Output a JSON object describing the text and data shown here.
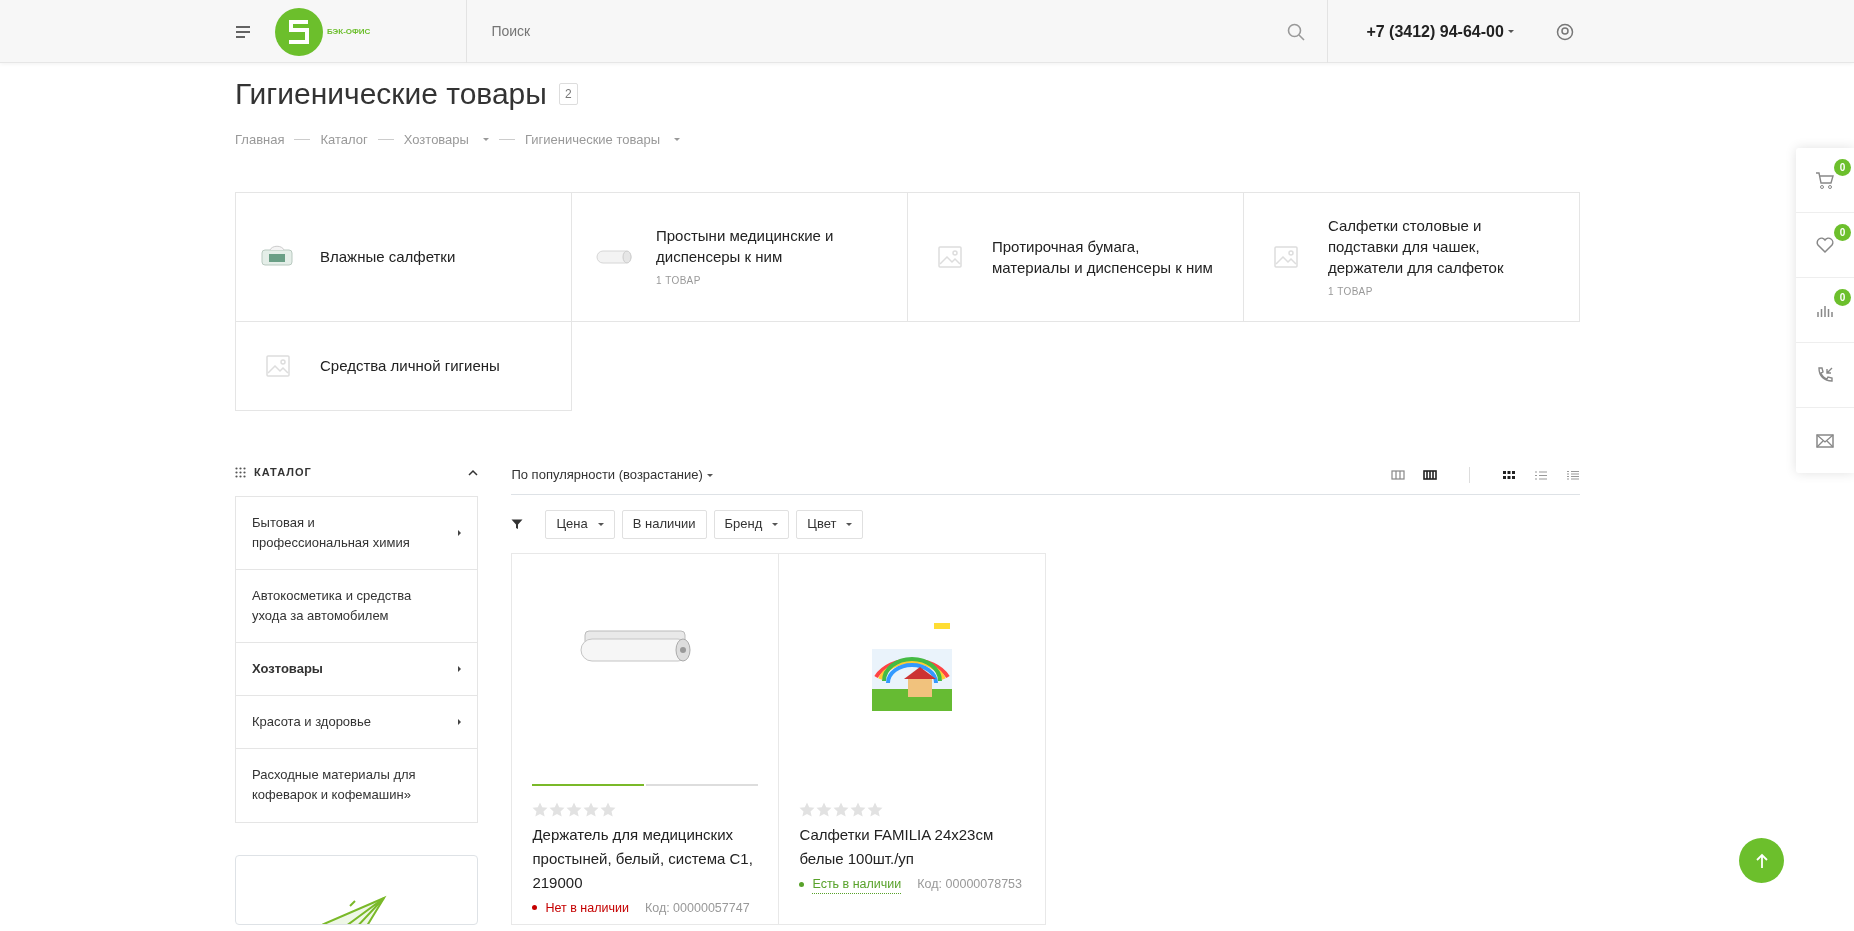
{
  "header": {
    "logo_text": "БЭК-ОФИС",
    "search_placeholder": "Поиск",
    "phone": "+7 (3412) 94-64-00"
  },
  "page": {
    "title": "Гигиенические товары",
    "count": "2",
    "breadcrumbs": [
      {
        "label": "Главная",
        "dropdown": false
      },
      {
        "label": "Каталог",
        "dropdown": false
      },
      {
        "label": "Хозтовары",
        "dropdown": true
      },
      {
        "label": "Гигиенические товары",
        "dropdown": true
      }
    ]
  },
  "categories": [
    {
      "name": "Влажные салфетки",
      "kind": "wipes"
    },
    {
      "name": "Простыни медицинские и диспенсеры к ним",
      "count": "1 ТОВАР",
      "kind": "roll"
    },
    {
      "name": "Протирочная бумага, материалы и диспенсеры к ним",
      "kind": "placeholder"
    },
    {
      "name": "Салфетки столовые и подставки для чашек, держатели для салфеток",
      "count": "1 ТОВАР",
      "kind": "placeholder"
    },
    {
      "name": "Средства личной гигиены",
      "kind": "placeholder"
    }
  ],
  "sidebar": {
    "title": "КАТАЛОГ",
    "expanded": true,
    "items": [
      {
        "label": "Бытовая и профессиональная химия",
        "selected": false,
        "has_children": true
      },
      {
        "label": "Автокосметика и средства ухода за автомобилем",
        "selected": false,
        "has_children": false
      },
      {
        "label": "Хозтовары",
        "selected": true,
        "has_children": true
      },
      {
        "label": "Красота и здоровье",
        "selected": false,
        "has_children": true
      },
      {
        "label": "Расходные материалы для кофеварок и кофемашин»",
        "selected": false,
        "has_children": false
      }
    ]
  },
  "sort": {
    "label": "По популярности (возрастание)"
  },
  "view_columns": [
    {
      "selected": false
    },
    {
      "selected": true
    }
  ],
  "view_modes": [
    {
      "kind": "tiles",
      "selected": true
    },
    {
      "kind": "list",
      "selected": false
    },
    {
      "kind": "table",
      "selected": false
    }
  ],
  "filters": [
    {
      "label": "Цена",
      "dropdown": true
    },
    {
      "label": "В наличии",
      "dropdown": false
    },
    {
      "label": "Бренд",
      "dropdown": true
    },
    {
      "label": "Цвет",
      "dropdown": true
    }
  ],
  "products": [
    {
      "name": "Держатель для медицинских простыней, белый, система С1, 219000",
      "kind": "roll",
      "gallery": [
        {
          "selected": true
        },
        {
          "selected": false
        }
      ],
      "stars": 0,
      "in_stock": false,
      "availability": "Нет в наличии",
      "code": "Код: 00000057747"
    },
    {
      "name": "Салфетки FAMILIA 24x23см белые 100шт./уп",
      "kind": "napkins",
      "stars": 0,
      "in_stock": true,
      "availability": "Есть в наличии",
      "code": "Код: 00000078753"
    }
  ],
  "side_panel": [
    {
      "kind": "cart",
      "badge": "0"
    },
    {
      "kind": "favorites",
      "badge": "0"
    },
    {
      "kind": "compare",
      "badge": "0"
    },
    {
      "kind": "callback"
    },
    {
      "kind": "mail"
    }
  ]
}
